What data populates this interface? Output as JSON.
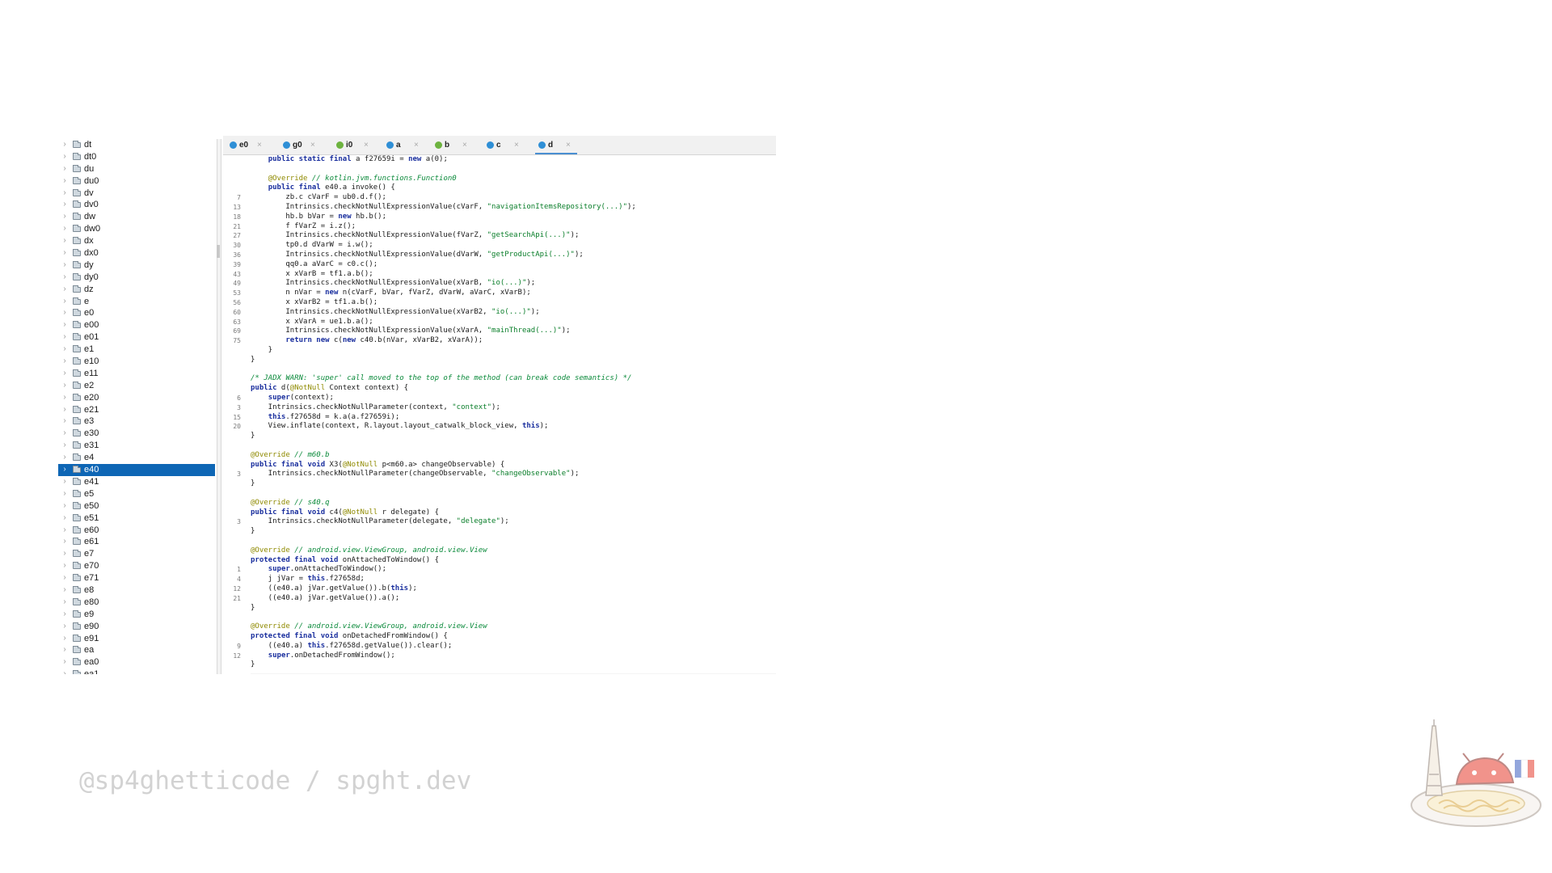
{
  "tree": {
    "items": [
      "dt",
      "dt0",
      "du",
      "du0",
      "dv",
      "dv0",
      "dw",
      "dw0",
      "dx",
      "dx0",
      "dy",
      "dy0",
      "dz",
      "e",
      "e0",
      "e00",
      "e01",
      "e1",
      "e10",
      "e11",
      "e2",
      "e20",
      "e21",
      "e3",
      "e30",
      "e31",
      "e4",
      "e40",
      "e41",
      "e5",
      "e50",
      "e51",
      "e60",
      "e61",
      "e7",
      "e70",
      "e71",
      "e8",
      "e80",
      "e9",
      "e90",
      "e91",
      "ea",
      "ea0",
      "ea1"
    ],
    "selected": "e40"
  },
  "tabs": [
    {
      "label": "e0",
      "kind": "class",
      "active": false
    },
    {
      "label": "g0",
      "kind": "class",
      "active": false
    },
    {
      "label": "i0",
      "kind": "interface",
      "active": false
    },
    {
      "label": "a",
      "kind": "class",
      "active": false
    },
    {
      "label": "b",
      "kind": "interface",
      "active": false
    },
    {
      "label": "c",
      "kind": "class",
      "active": false
    },
    {
      "label": "d",
      "kind": "class",
      "active": true
    }
  ],
  "tab_close_glyph": "×",
  "code": [
    {
      "ln": "",
      "segs": [
        [
          "    ",
          ""
        ],
        [
          "public static final",
          "kw"
        ],
        [
          " a f27659i = ",
          ""
        ],
        [
          "new",
          "kw"
        ],
        [
          " a(0);",
          ""
        ]
      ]
    },
    {
      "ln": "",
      "segs": []
    },
    {
      "ln": "",
      "segs": [
        [
          "    ",
          ""
        ],
        [
          "@Override",
          "an"
        ],
        [
          " ",
          ""
        ],
        [
          "// kotlin.jvm.functions.Function0",
          "cm"
        ]
      ]
    },
    {
      "ln": "",
      "segs": [
        [
          "    ",
          ""
        ],
        [
          "public final",
          "kw"
        ],
        [
          " e40.a invoke() {",
          ""
        ]
      ]
    },
    {
      "ln": "7",
      "segs": [
        [
          "        zb.c cVarF = ub0.d.f();",
          ""
        ]
      ]
    },
    {
      "ln": "13",
      "segs": [
        [
          "        Intrinsics.checkNotNullExpressionValue(cVarF, ",
          ""
        ],
        [
          "\"navigationItemsRepository(...)\"",
          "st"
        ],
        [
          ");",
          ""
        ]
      ]
    },
    {
      "ln": "18",
      "segs": [
        [
          "        hb.b bVar = ",
          ""
        ],
        [
          "new",
          "kw"
        ],
        [
          " hb.b();",
          ""
        ]
      ]
    },
    {
      "ln": "21",
      "segs": [
        [
          "        f fVarZ = i.z();",
          ""
        ]
      ]
    },
    {
      "ln": "27",
      "segs": [
        [
          "        Intrinsics.checkNotNullExpressionValue(fVarZ, ",
          ""
        ],
        [
          "\"getSearchApi(...)\"",
          "st"
        ],
        [
          ");",
          ""
        ]
      ]
    },
    {
      "ln": "30",
      "segs": [
        [
          "        tp0.d dVarW = i.w();",
          ""
        ]
      ]
    },
    {
      "ln": "36",
      "segs": [
        [
          "        Intrinsics.checkNotNullExpressionValue(dVarW, ",
          ""
        ],
        [
          "\"getProductApi(...)\"",
          "st"
        ],
        [
          ");",
          ""
        ]
      ]
    },
    {
      "ln": "39",
      "segs": [
        [
          "        qq0.a aVarC = c0.c();",
          ""
        ]
      ]
    },
    {
      "ln": "43",
      "segs": [
        [
          "        x xVarB = tf1.a.b();",
          ""
        ]
      ]
    },
    {
      "ln": "49",
      "segs": [
        [
          "        Intrinsics.checkNotNullExpressionValue(xVarB, ",
          ""
        ],
        [
          "\"io(...)\"",
          "st"
        ],
        [
          ");",
          ""
        ]
      ]
    },
    {
      "ln": "53",
      "segs": [
        [
          "        n nVar = ",
          ""
        ],
        [
          "new",
          "kw"
        ],
        [
          " n(cVarF, bVar, fVarZ, dVarW, aVarC, xVarB);",
          ""
        ]
      ]
    },
    {
      "ln": "56",
      "segs": [
        [
          "        x xVarB2 = tf1.a.b();",
          ""
        ]
      ]
    },
    {
      "ln": "60",
      "segs": [
        [
          "        Intrinsics.checkNotNullExpressionValue(xVarB2, ",
          ""
        ],
        [
          "\"io(...)\"",
          "st"
        ],
        [
          ");",
          ""
        ]
      ]
    },
    {
      "ln": "63",
      "segs": [
        [
          "        x xVarA = ue1.b.a();",
          ""
        ]
      ]
    },
    {
      "ln": "69",
      "segs": [
        [
          "        Intrinsics.checkNotNullExpressionValue(xVarA, ",
          ""
        ],
        [
          "\"mainThread(...)\"",
          "st"
        ],
        [
          ");",
          ""
        ]
      ]
    },
    {
      "ln": "75",
      "segs": [
        [
          "        ",
          ""
        ],
        [
          "return new",
          "kw"
        ],
        [
          " c(",
          ""
        ],
        [
          "new",
          "kw"
        ],
        [
          " c40.b(nVar, xVarB2, xVarA));",
          ""
        ]
      ]
    },
    {
      "ln": "",
      "segs": [
        [
          "    }",
          ""
        ]
      ]
    },
    {
      "ln": "",
      "segs": [
        [
          "}",
          ""
        ]
      ]
    },
    {
      "ln": "",
      "segs": []
    },
    {
      "ln": "",
      "segs": [
        [
          "/* JADX WARN: 'super' call moved to the top of the method (can break code semantics) */",
          "cm"
        ]
      ]
    },
    {
      "ln": "",
      "segs": [
        [
          "public",
          "kw"
        ],
        [
          " d(",
          ""
        ],
        [
          "@NotNull",
          "an"
        ],
        [
          " Context context) {",
          ""
        ]
      ]
    },
    {
      "ln": "6",
      "segs": [
        [
          "    ",
          ""
        ],
        [
          "super",
          "kw"
        ],
        [
          "(context);",
          ""
        ]
      ]
    },
    {
      "ln": "3",
      "segs": [
        [
          "    Intrinsics.checkNotNullParameter(context, ",
          ""
        ],
        [
          "\"context\"",
          "st"
        ],
        [
          ");",
          ""
        ]
      ]
    },
    {
      "ln": "15",
      "segs": [
        [
          "    ",
          ""
        ],
        [
          "this",
          "kw"
        ],
        [
          ".f27658d = k.a(a.f27659i);",
          ""
        ]
      ]
    },
    {
      "ln": "20",
      "segs": [
        [
          "    View.inflate(context, R.layout.layout_catwalk_block_view, ",
          ""
        ],
        [
          "this",
          "kw"
        ],
        [
          ");",
          ""
        ]
      ]
    },
    {
      "ln": "",
      "segs": [
        [
          "}",
          ""
        ]
      ]
    },
    {
      "ln": "",
      "segs": []
    },
    {
      "ln": "",
      "segs": [
        [
          "@Override",
          "an"
        ],
        [
          " ",
          ""
        ],
        [
          "// m60.b",
          "cm"
        ]
      ]
    },
    {
      "ln": "",
      "segs": [
        [
          "public final void",
          "kw"
        ],
        [
          " X3(",
          ""
        ],
        [
          "@NotNull",
          "an"
        ],
        [
          " p<m60.a> changeObservable) {",
          ""
        ]
      ]
    },
    {
      "ln": "3",
      "segs": [
        [
          "    Intrinsics.checkNotNullParameter(changeObservable, ",
          ""
        ],
        [
          "\"changeObservable\"",
          "st"
        ],
        [
          ");",
          ""
        ]
      ]
    },
    {
      "ln": "",
      "segs": [
        [
          "}",
          ""
        ]
      ]
    },
    {
      "ln": "",
      "segs": []
    },
    {
      "ln": "",
      "segs": [
        [
          "@Override",
          "an"
        ],
        [
          " ",
          ""
        ],
        [
          "// s40.q",
          "cm"
        ]
      ]
    },
    {
      "ln": "",
      "segs": [
        [
          "public final void",
          "kw"
        ],
        [
          " c4(",
          ""
        ],
        [
          "@NotNull",
          "an"
        ],
        [
          " r delegate) {",
          ""
        ]
      ]
    },
    {
      "ln": "3",
      "segs": [
        [
          "    Intrinsics.checkNotNullParameter(delegate, ",
          ""
        ],
        [
          "\"delegate\"",
          "st"
        ],
        [
          ");",
          ""
        ]
      ]
    },
    {
      "ln": "",
      "segs": [
        [
          "}",
          ""
        ]
      ]
    },
    {
      "ln": "",
      "segs": []
    },
    {
      "ln": "",
      "segs": [
        [
          "@Override",
          "an"
        ],
        [
          " ",
          ""
        ],
        [
          "// android.view.ViewGroup, android.view.View",
          "cm"
        ]
      ]
    },
    {
      "ln": "",
      "segs": [
        [
          "protected final void",
          "kw"
        ],
        [
          " onAttachedToWindow() {",
          ""
        ]
      ]
    },
    {
      "ln": "1",
      "segs": [
        [
          "    ",
          ""
        ],
        [
          "super",
          "kw"
        ],
        [
          ".onAttachedToWindow();",
          ""
        ]
      ]
    },
    {
      "ln": "4",
      "segs": [
        [
          "    j jVar = ",
          ""
        ],
        [
          "this",
          "kw"
        ],
        [
          ".f27658d;",
          ""
        ]
      ]
    },
    {
      "ln": "12",
      "segs": [
        [
          "    ((e40.a) jVar.getValue()).b(",
          ""
        ],
        [
          "this",
          "kw"
        ],
        [
          ");",
          ""
        ]
      ]
    },
    {
      "ln": "21",
      "segs": [
        [
          "    ((e40.a) jVar.getValue()).a();",
          ""
        ]
      ]
    },
    {
      "ln": "",
      "segs": [
        [
          "}",
          ""
        ]
      ]
    },
    {
      "ln": "",
      "segs": []
    },
    {
      "ln": "",
      "segs": [
        [
          "@Override",
          "an"
        ],
        [
          " ",
          ""
        ],
        [
          "// android.view.ViewGroup, android.view.View",
          "cm"
        ]
      ]
    },
    {
      "ln": "",
      "segs": [
        [
          "protected final void",
          "kw"
        ],
        [
          " onDetachedFromWindow() {",
          ""
        ]
      ]
    },
    {
      "ln": "9",
      "segs": [
        [
          "    ((e40.a) ",
          ""
        ],
        [
          "this",
          "kw"
        ],
        [
          ".f27658d.getValue()).clear();",
          ""
        ]
      ]
    },
    {
      "ln": "12",
      "segs": [
        [
          "    ",
          ""
        ],
        [
          "super",
          "kw"
        ],
        [
          ".onDetachedFromWindow();",
          ""
        ]
      ]
    },
    {
      "ln": "",
      "segs": [
        [
          "}",
          ""
        ]
      ]
    }
  ],
  "footer": {
    "handle": "@sp4ghetticode / spght.dev"
  },
  "colors": {
    "selection": "#0e66b5",
    "keyword": "#1a2f9e",
    "string": "#0a7e2a",
    "comment": "#0b8a3b",
    "annotation": "#8f8a00"
  }
}
